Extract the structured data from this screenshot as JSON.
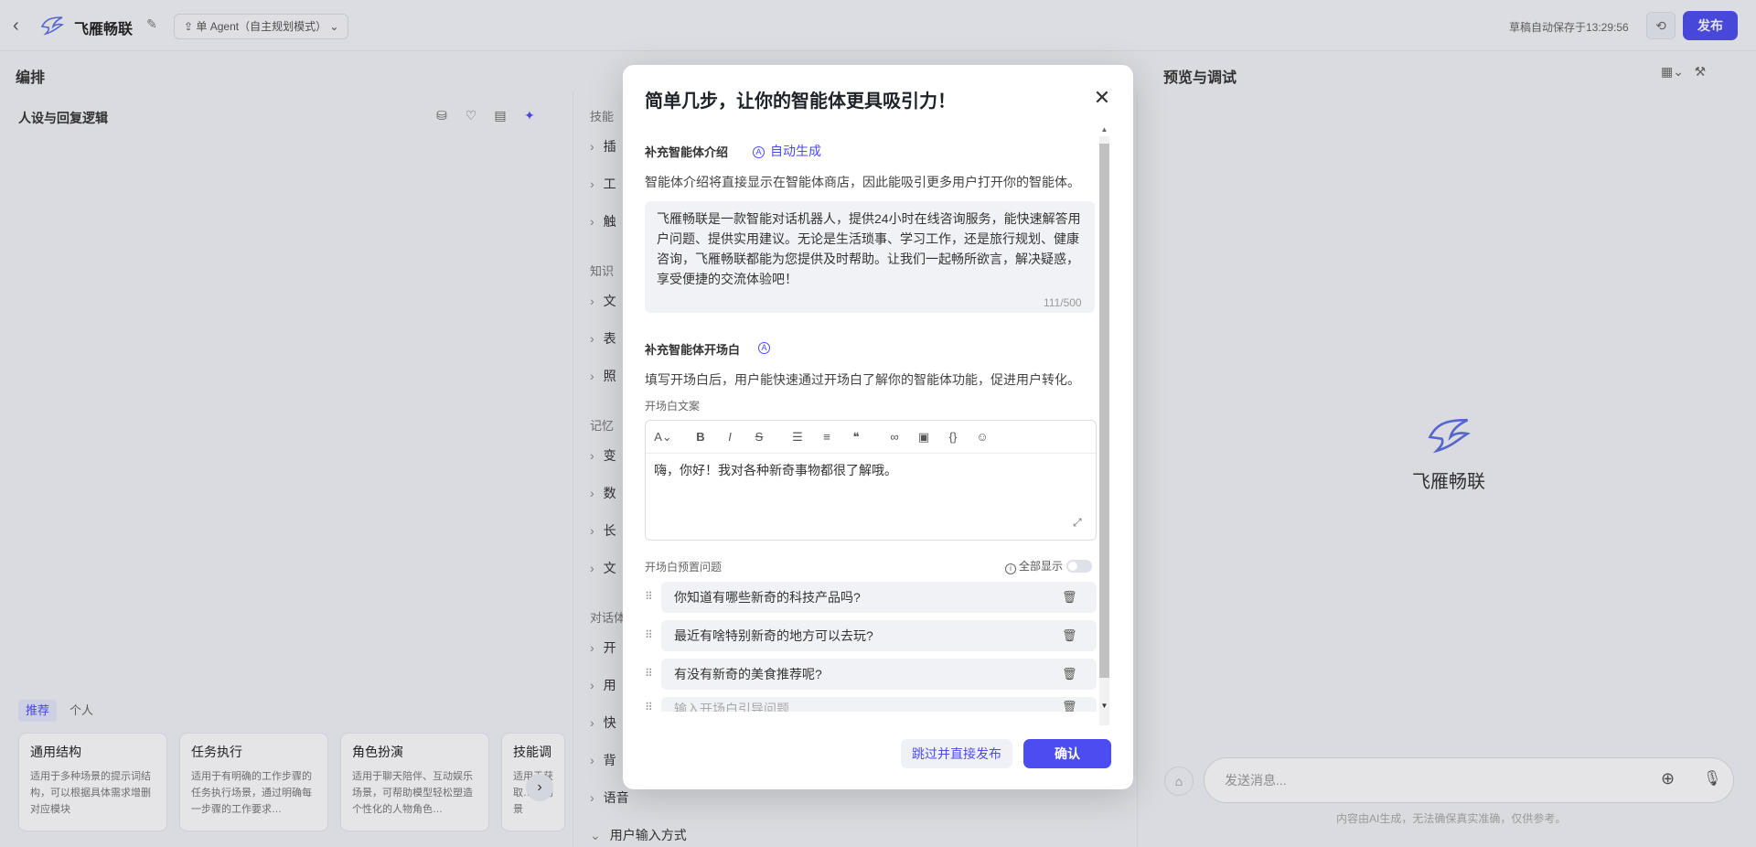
{
  "header": {
    "app_name": "飞雁畅联",
    "mode": "单 Agent（自主规划模式）",
    "autosave": "草稿自动保存于13:29:56",
    "publish": "发布"
  },
  "left": {
    "title": "编排",
    "persona": "人设与回复逻辑",
    "tabs": [
      "推荐",
      "个人"
    ],
    "templates": [
      {
        "name": "通用结构",
        "desc": "适用于多种场景的提示词结构，可以根据具体需求增删对应模块"
      },
      {
        "name": "任务执行",
        "desc": "适用于有明确的工作步骤的任务执行场景，通过明确每一步骤的工作要求…"
      },
      {
        "name": "角色扮演",
        "desc": "适用于聊天陪伴、互动娱乐场景，可帮助模型轻松塑造个性化的人物角色…"
      },
      {
        "name": "技能调",
        "desc": "适用于获取…的场景"
      }
    ]
  },
  "middle": {
    "groups": {
      "skills": "技能",
      "knowledge": "知识",
      "memory": "记忆",
      "dialog": "对话体"
    },
    "items": [
      "插",
      "工",
      "触",
      "文",
      "表",
      "照",
      "变",
      "数",
      "长",
      "文",
      "开",
      "用",
      "快",
      "背"
    ],
    "voice": "语音",
    "input_method": "用户输入方式"
  },
  "right": {
    "title": "预览与调试",
    "bot_name": "飞雁畅联",
    "input_placeholder": "发送消息...",
    "note": "内容由AI生成，无法确保真实准确，仅供参考。"
  },
  "modal": {
    "title": "简单几步，让你的智能体更具吸引力！",
    "intro_label": "补充智能体介绍",
    "auto_generate": "自动生成",
    "intro_desc": "智能体介绍将直接显示在智能体商店，因此能吸引更多用户打开你的智能体。",
    "intro_text": "飞雁畅联是一款智能对话机器人，提供24小时在线咨询服务，能快速解答用户问题、提供实用建议。无论是生活琐事、学习工作，还是旅行规划、健康咨询，飞雁畅联都能为您提供及时帮助。让我们一起畅所欲言，解决疑惑，享受便捷的交流体验吧！",
    "intro_count": "111/500",
    "opening_label": "补充智能体开场白",
    "opening_desc": "填写开场白后，用户能快速通过开场白了解你的智能体功能，促进用户转化。",
    "opening_copy_label": "开场白文案",
    "opening_text": "嗨，你好！我对各种新奇事物都很了解哦。",
    "preset_label": "开场白预置问题",
    "show_all": "全部显示",
    "questions": [
      "你知道有哪些新奇的科技产品吗?",
      "最近有啥特别新奇的地方可以去玩?",
      "有没有新奇的美食推荐呢?"
    ],
    "question_placeholder": "输入开场白引导问题",
    "skip_button": "跳过并直接发布",
    "confirm_button": "确认"
  }
}
